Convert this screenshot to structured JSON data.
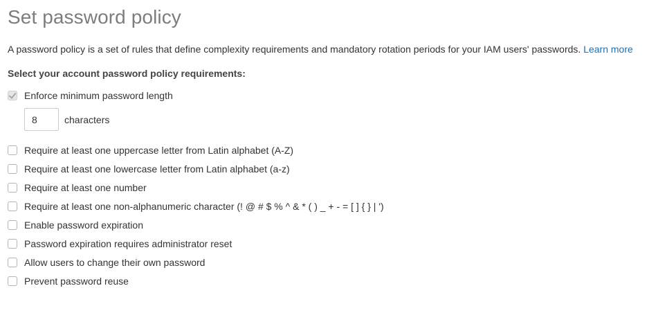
{
  "header": {
    "title": "Set password policy"
  },
  "intro": {
    "text": "A password policy is a set of rules that define complexity requirements and mandatory rotation periods for your IAM users' passwords.",
    "link_label": "Learn more"
  },
  "policy": {
    "heading": "Select your account password policy requirements:",
    "min_length": {
      "label": "Enforce minimum password length",
      "checked": true,
      "disabled": true,
      "value": "8",
      "unit_label": "characters"
    },
    "options": [
      {
        "label": "Require at least one uppercase letter from Latin alphabet (A-Z)",
        "checked": false
      },
      {
        "label": "Require at least one lowercase letter from Latin alphabet (a-z)",
        "checked": false
      },
      {
        "label": "Require at least one number",
        "checked": false
      },
      {
        "label": "Require at least one non-alphanumeric character (! @ # $ % ^ & * ( ) _ + - = [ ] { } | ')",
        "checked": false
      },
      {
        "label": "Enable password expiration",
        "checked": false
      },
      {
        "label": "Password expiration requires administrator reset",
        "checked": false
      },
      {
        "label": "Allow users to change their own password",
        "checked": false
      },
      {
        "label": "Prevent password reuse",
        "checked": false
      }
    ]
  },
  "colors": {
    "title": "#7d7d7d",
    "link": "#1a6fb5",
    "text": "#333333"
  }
}
